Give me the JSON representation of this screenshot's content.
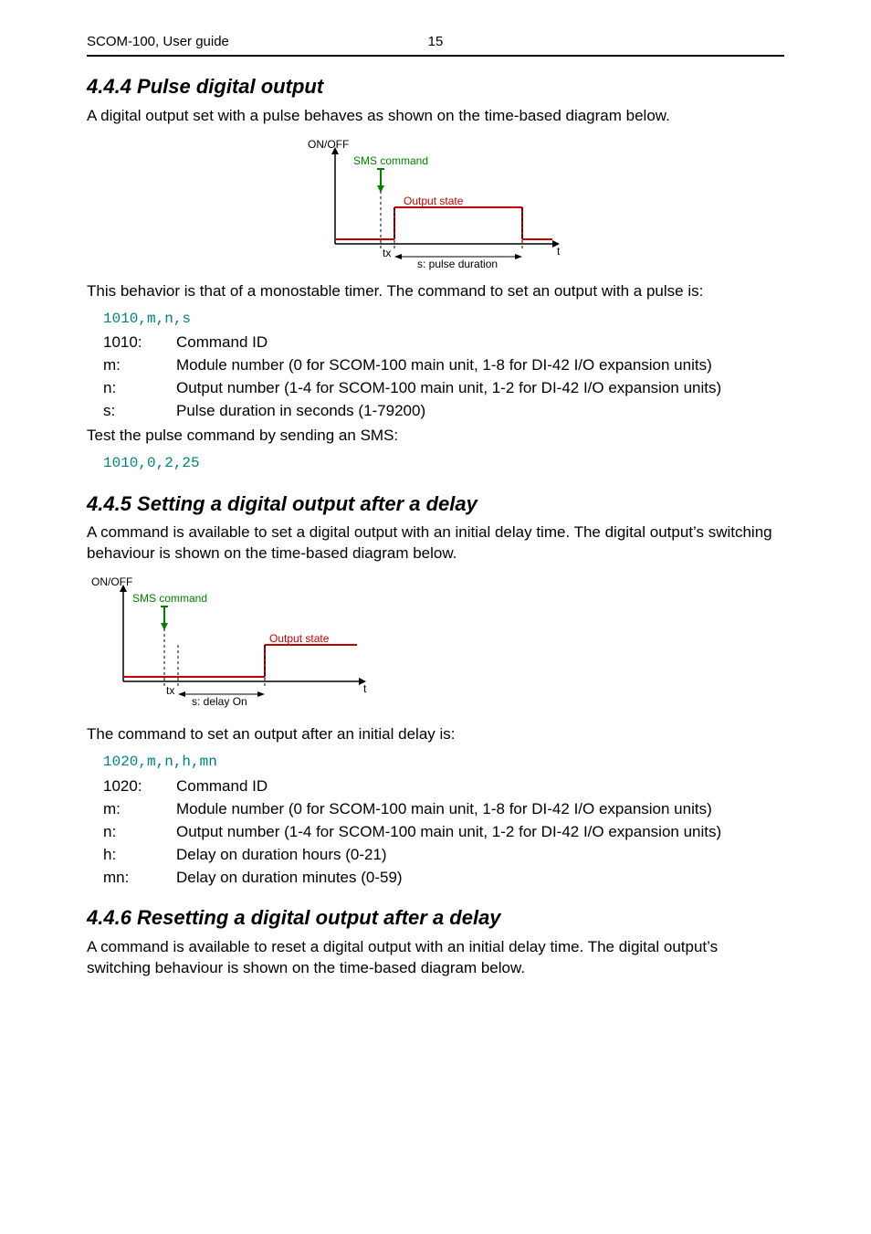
{
  "header": {
    "left": "SCOM-100, User guide",
    "page": "15"
  },
  "sec444": {
    "heading": "4.4.4 Pulse digital output",
    "intro": "A digital output set with a pulse behaves as shown on the time-based diagram below.",
    "diagram": {
      "ylabel": "ON/OFF",
      "sms": "SMS command",
      "output": "Output state",
      "tx": "tx",
      "dur": "s: pulse duration",
      "t": "t"
    },
    "after_diag": "This behavior is that of a monostable timer. The command to set an output with a pulse is:",
    "code": "1010,m,n,s",
    "params": {
      "k1": "1010:",
      "d1": "Command ID",
      "k2": "m:",
      "d2": "Module number (0 for SCOM-100 main unit, 1-8 for DI-42 I/O expansion units)",
      "k3": "n:",
      "d3": "Output number (1-4 for SCOM-100 main unit, 1-2 for DI-42 I/O expansion units)",
      "k4": "s:",
      "d4": "Pulse duration in seconds (1-79200)"
    },
    "test_line": "Test the pulse command by sending an SMS:",
    "code2": "1010,0,2,25"
  },
  "sec445": {
    "heading": "4.4.5 Setting a digital output after a delay",
    "intro": "A command is available to set a digital output with an initial delay time. The digital output’s switching behaviour is shown on the time-based diagram below.",
    "diagram": {
      "ylabel": "ON/OFF",
      "sms": "SMS command",
      "output": "Output state",
      "tx": "tx",
      "dur": "s: delay On",
      "t": "t"
    },
    "after_diag": "The command to set an output after an initial delay is:",
    "code": "1020,m,n,h,mn",
    "params": {
      "k1": "1020:",
      "d1": "Command ID",
      "k2": "m:",
      "d2": "Module number (0 for SCOM-100 main unit, 1-8 for DI-42 I/O expansion units)",
      "k3": "n:",
      "d3": "Output number (1-4 for SCOM-100 main unit, 1-2 for DI-42 I/O expansion units)",
      "k4": "h:",
      "d4": "Delay on duration hours (0-21)",
      "k5": "mn:",
      "d5": "Delay on duration minutes (0-59)"
    }
  },
  "sec446": {
    "heading": "4.4.6 Resetting a digital output after a delay",
    "intro": "A command is available to reset a digital output with an initial delay time. The digital output’s switching behaviour is shown on the time-based diagram below."
  }
}
